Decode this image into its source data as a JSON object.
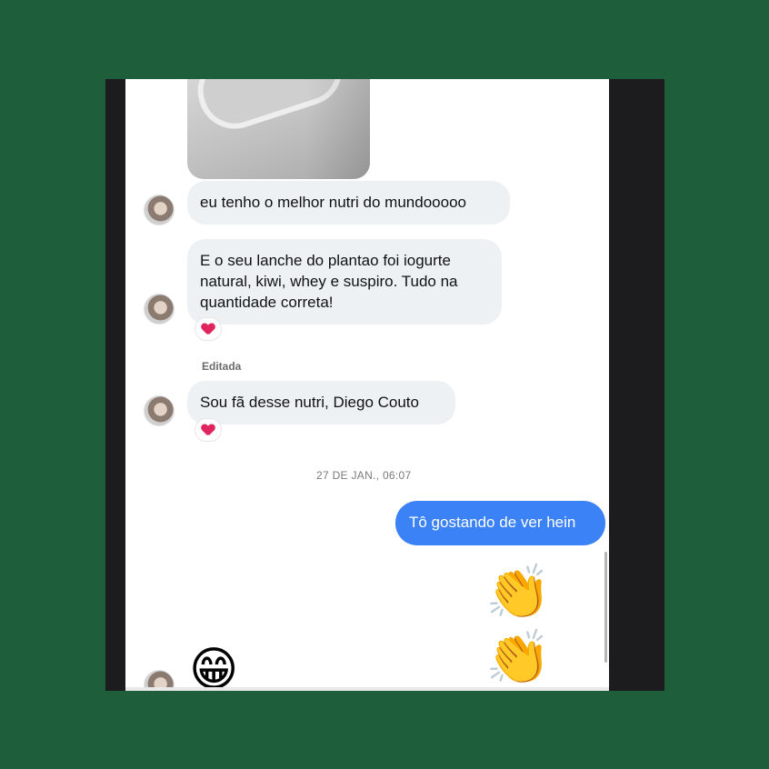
{
  "chat": {
    "messages_in": [
      "eu tenho o melhor nutri do mundooooo",
      "E o seu lanche do plantao foi iogurte natural, kiwi, whey e suspiro. Tudo na quantidade correta!",
      "Sou fã desse nutri, Diego Couto"
    ],
    "edited_label": "Editada",
    "timestamp": "27 DE JAN., 06:07",
    "message_out": "Tô gostando de ver hein",
    "emoji_out": "👏👏",
    "emoji_in": "😁",
    "reaction": "heart-icon"
  },
  "colors": {
    "outer_background": "#1e5e3b",
    "outgoing_bubble": "#3b82f6",
    "incoming_bubble": "#eef1f4",
    "reaction_heart": "#e0245e"
  }
}
